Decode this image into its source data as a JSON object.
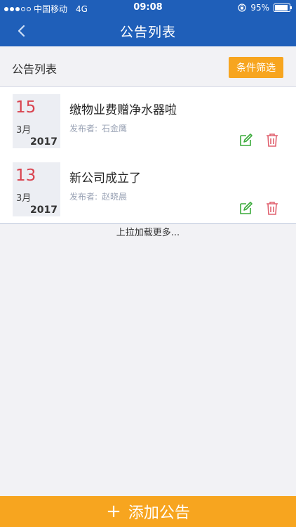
{
  "status_bar": {
    "carrier": "中国移动",
    "network": "4G",
    "time": "09:08",
    "battery": "95%"
  },
  "nav": {
    "title": "公告列表",
    "back_icon": "chevron-left-icon"
  },
  "section": {
    "label": "公告列表",
    "filter_label": "条件筛选"
  },
  "announcements": [
    {
      "day": "15",
      "month": "3月",
      "year": "2017",
      "title": "缴物业费赠净水器啦",
      "publisher_label": "发布者:",
      "publisher_name": "石金鹰"
    },
    {
      "day": "13",
      "month": "3月",
      "year": "2017",
      "title": "新公司成立了",
      "publisher_label": "发布者:",
      "publisher_name": "赵晓晨"
    }
  ],
  "load_more": "上拉加载更多...",
  "add_button": {
    "plus": "+",
    "label": "添加公告"
  },
  "colors": {
    "primary": "#1f5fb9",
    "accent": "#f7a51f",
    "day": "#d9424e",
    "edit": "#3cab3c",
    "delete": "#e0606e"
  }
}
